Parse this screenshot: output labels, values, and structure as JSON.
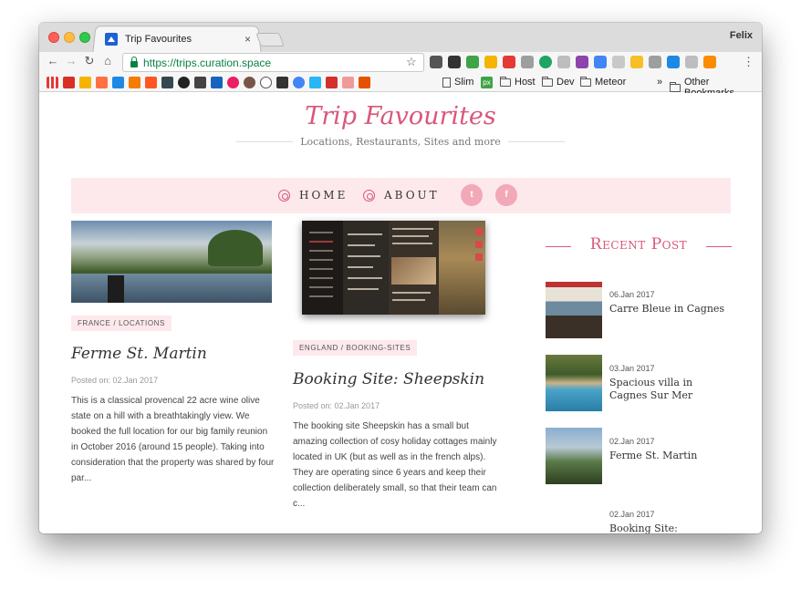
{
  "browser": {
    "tab_title": "Trip Favourites",
    "tab_close": "×",
    "profile_name": "Felix",
    "url": "https://trips.curation.space",
    "nav": {
      "back": "←",
      "forward": "→",
      "reload": "↻",
      "home": "⌂",
      "star": "☆",
      "menu": "⋮"
    },
    "bookmarks": {
      "slim": "Slim",
      "host": "Host",
      "dev": "Dev",
      "meteor": "Meteor",
      "overflow": "»",
      "other": "Other Bookmarks",
      "px": "px"
    }
  },
  "site": {
    "logo": "Trip Favourites",
    "tagline": "Locations, Restaurants, Sites and more",
    "nav": [
      {
        "label": "HOME"
      },
      {
        "label": "ABOUT"
      }
    ],
    "social": {
      "twitter": "t",
      "facebook": "f"
    }
  },
  "posts": [
    {
      "category": "FRANCE / LOCATIONS",
      "title": "Ferme St. Martin",
      "date": "Posted on: 02.Jan 2017",
      "excerpt": "This is a classical provencal 22 acre wine olive state on a hill with a breathtakingly view. We booked the full location for our big family reunion in October 2016 (around 15 people). Taking into consideration that the property was shared by four par..."
    },
    {
      "category": "ENGLAND / BOOKING-SITES",
      "title": "Booking Site: Sheepskin",
      "date": "Posted on: 02.Jan 2017",
      "excerpt": "The booking site Sheepskin has a small but amazing collection of cosy holiday cottages mainly located in UK (but as well as in the french alps).  They are operating since 6 years and keep their collection deliberately small,  so that their team can c..."
    }
  ],
  "sidebar": {
    "title": "Recent Post",
    "items": [
      {
        "date": "06.Jan 2017",
        "title": "Carre Bleue in Cagnes"
      },
      {
        "date": "03.Jan 2017",
        "title": "Spacious villa in Cagnes Sur Mer"
      },
      {
        "date": "02.Jan 2017",
        "title": "Ferme St. Martin"
      },
      {
        "date": "02.Jan 2017",
        "title": "Booking Site: Sheepskin"
      }
    ]
  },
  "colors": {
    "accent": "#d9577a",
    "nav_bg": "#fde9ec",
    "social_bg": "#f2a8b6",
    "url_green": "#0b8043"
  }
}
